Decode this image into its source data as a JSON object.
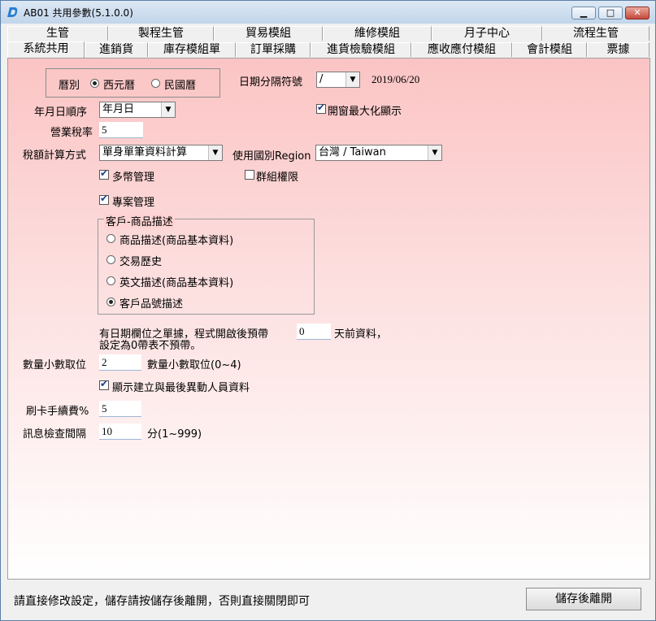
{
  "window": {
    "title": "AB01 共用參數(5.1.0.0)"
  },
  "tabs_row1": [
    "生管",
    "製程生管",
    "貿易模組",
    "維修模組",
    "月子中心",
    "流程生管"
  ],
  "tabs_row2": [
    "系統共用",
    "進銷貨",
    "庫存模組單",
    "訂單採購",
    "進貨檢驗模組",
    "應收應付模組",
    "會計模組",
    "票據"
  ],
  "active_tab": "系統共用",
  "calendar": {
    "label": "曆別",
    "opt_western": "西元曆",
    "opt_roc": "民國曆",
    "selected": "西元曆"
  },
  "date_separator": {
    "label": "日期分隔符號",
    "value": "/",
    "sample": "2019/06/20"
  },
  "date_order": {
    "label": "年月日順序",
    "value": "年月日"
  },
  "maximize": {
    "label": "開窗最大化顯示",
    "checked": true
  },
  "tax_rate": {
    "label": "營業稅率",
    "value": "5"
  },
  "tax_method": {
    "label": "稅額計算方式",
    "value": "單身單筆資料計算"
  },
  "region": {
    "label": "使用國別Region",
    "value": "台灣 / Taiwan"
  },
  "multi_currency": {
    "label": "多幣管理",
    "checked": true
  },
  "group_permission": {
    "label": "群組權限",
    "checked": false
  },
  "project": {
    "label": "專案管理",
    "checked": true
  },
  "desc_group": {
    "title": "客戶-商品描述",
    "options": [
      "商品描述(商品基本資料)",
      "交易歷史",
      "英文描述(商品基本資料)",
      "客戶品號描述"
    ],
    "selected": "客戶品號描述"
  },
  "prefetch": {
    "text1": "有日期欄位之單據，程式開啟後預帶",
    "value": "0",
    "text2": "天前資料，",
    "text3": "設定為0帶表不預帶。"
  },
  "qty_decimal": {
    "label": "數量小數取位",
    "value": "2",
    "hint": "數量小數取位(0~4)"
  },
  "show_creator": {
    "label": "顯示建立與最後異動人員資料",
    "checked": true
  },
  "card_fee": {
    "label": "刷卡手續費%",
    "value": "5"
  },
  "msg_interval": {
    "label": "訊息檢查間隔",
    "value": "10",
    "hint": "分(1~999)"
  },
  "status": {
    "text": "請直接修改設定，儲存請按儲存後離開，否則直接關閉即可"
  },
  "save_button": "儲存後離開",
  "colors": {
    "accent": "#fbc4c4",
    "titlebar": "#c2d5ea"
  },
  "icons": {
    "app": "app-logo-icon",
    "minimize": "minimize-icon",
    "maximize": "maximize-icon",
    "close": "close-icon"
  }
}
